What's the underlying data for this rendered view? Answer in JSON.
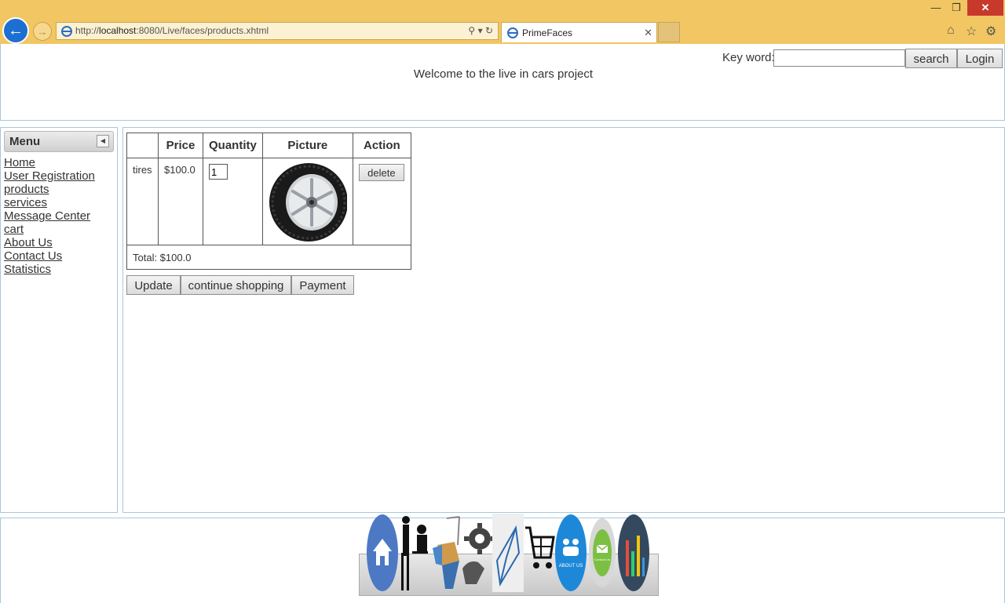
{
  "browser": {
    "url_prefix": "http://",
    "url_host": "localhost",
    "url_rest": ":8080/Live/faces/products.xhtml",
    "tab_title": "PrimeFaces"
  },
  "header": {
    "keyword_label": "Key word:",
    "keyword_value": "",
    "search_label": "search",
    "login_label": "Login",
    "welcome_text": "Welcome to the live in cars project"
  },
  "menu": {
    "title": "Menu",
    "items": [
      {
        "label": "Home"
      },
      {
        "label": "User Registration"
      },
      {
        "label": "products"
      },
      {
        "label": "services"
      },
      {
        "label": "Message Center"
      },
      {
        "label": "cart"
      },
      {
        "label": "About Us"
      },
      {
        "label": "Contact Us"
      },
      {
        "label": "Statistics"
      }
    ]
  },
  "cart": {
    "headers": [
      "",
      "Price",
      "Quantity",
      "Picture",
      "Action"
    ],
    "rows": [
      {
        "name": "tires",
        "price": "$100.0",
        "quantity": "1",
        "delete_label": "delete"
      }
    ],
    "total": "Total: $100.0"
  },
  "actions": {
    "update_label": "Update",
    "continue_label": "continue shopping",
    "payment_label": "Payment"
  },
  "dock": {
    "icons": [
      "home-icon",
      "users-icon",
      "products-box-icon",
      "services-gear-icon",
      "message-icon",
      "cart-icon",
      "about-us-icon",
      "contact-us-icon",
      "statistics-icon"
    ],
    "about_text": "ABOUT US",
    "contact_text": "Contact Us"
  },
  "colors": {
    "chrome": "#f2c662",
    "panel_border": "#a8c8dc",
    "close_button": "#c7392b"
  }
}
